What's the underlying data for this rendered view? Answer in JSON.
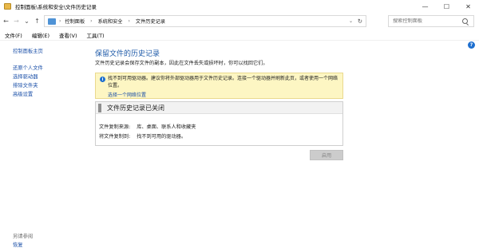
{
  "window": {
    "title": "控制面板\\系统和安全\\文件历史记录",
    "minimize": "—",
    "maximize": "☐",
    "close": "✕"
  },
  "nav": {
    "back": "←",
    "forward": "→",
    "recent": "⌄",
    "up": "↑"
  },
  "address": {
    "crumbs": [
      "控制面板",
      "系统和安全",
      "文件历史记录"
    ],
    "separator": "›",
    "dropdown": "⌄",
    "refresh": "↻"
  },
  "search": {
    "placeholder": "搜索控制面板"
  },
  "menu": {
    "items": [
      "文件(F)",
      "编辑(E)",
      "查看(V)",
      "工具(T)"
    ]
  },
  "help": "?",
  "sidebar": {
    "home": "控制面板主页",
    "links": [
      "还原个人文件",
      "选择驱动器",
      "排除文件夹",
      "高级设置"
    ],
    "see_also_label": "另请参阅",
    "see_also_links": [
      "恢复"
    ]
  },
  "main": {
    "title": "保留文件的历史记录",
    "description": "文件历史记录会保存文件的副本，因此在文件丢失或损坏时，你可以找回它们。"
  },
  "warning": {
    "icon_glyph": "i",
    "text": "找不到可用驱动器。建议你将外部驱动器用于文件历史记录。连接一个驱动器并刷新此页，或者使用一个网络位置。",
    "link": "选择一个网络位置"
  },
  "status": {
    "title": "文件历史记录已关闭",
    "copy_from_label": "文件复制来源:",
    "copy_from_value": "库、桌面、联系人和收藏夹",
    "copy_to_label": "将文件复制到:",
    "copy_to_value": "找不到可用的驱动器。"
  },
  "buttons": {
    "enable": "启用"
  },
  "colors": {
    "link": "#1a4fa8",
    "title_blue": "#1e5aa8",
    "warning_bg": "#fdf6c3",
    "disabled_button": "#cccccc"
  }
}
